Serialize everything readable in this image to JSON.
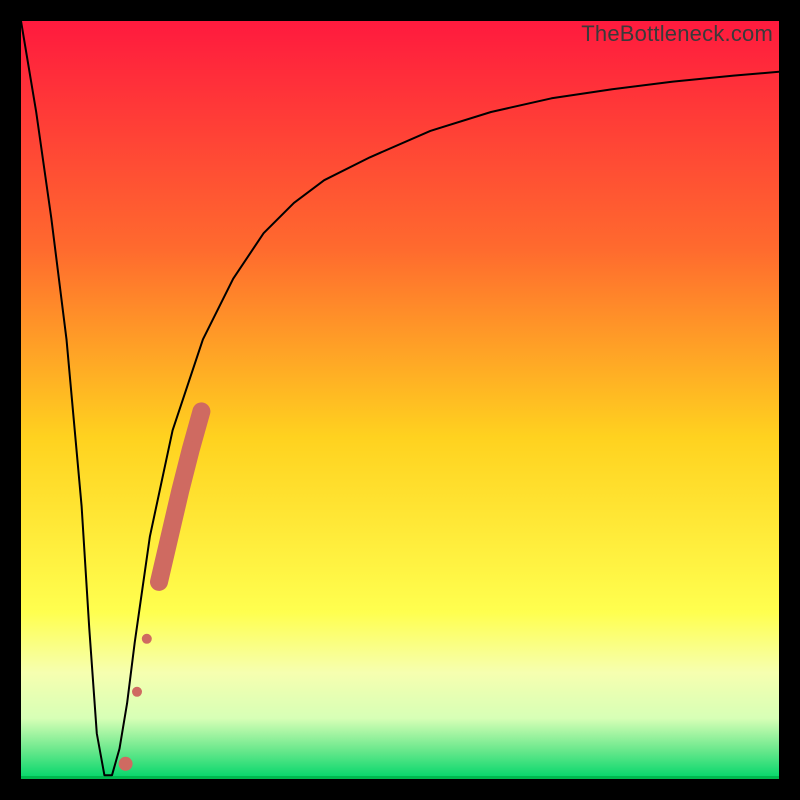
{
  "watermark": "TheBottleneck.com",
  "chart_data": {
    "type": "line",
    "title": "",
    "xlabel": "",
    "ylabel": "",
    "xlim": [
      0,
      100
    ],
    "ylim": [
      0,
      100
    ],
    "gradient_stops": [
      {
        "offset": 0,
        "color": "#ff1a3e"
      },
      {
        "offset": 30,
        "color": "#ff6a2e"
      },
      {
        "offset": 55,
        "color": "#ffd21f"
      },
      {
        "offset": 78,
        "color": "#ffff4f"
      },
      {
        "offset": 86,
        "color": "#f6ffb0"
      },
      {
        "offset": 92,
        "color": "#d7ffb6"
      },
      {
        "offset": 96,
        "color": "#6fe98e"
      },
      {
        "offset": 100,
        "color": "#00d66a"
      }
    ],
    "series": [
      {
        "name": "bottleneck-curve",
        "x": [
          0,
          2,
          4,
          6,
          8,
          9,
          10,
          11,
          12,
          13,
          14,
          15,
          17,
          20,
          24,
          28,
          32,
          36,
          40,
          46,
          54,
          62,
          70,
          78,
          86,
          94,
          100
        ],
        "y": [
          100,
          88,
          74,
          58,
          36,
          20,
          6,
          0.5,
          0.5,
          4,
          10,
          18,
          32,
          46,
          58,
          66,
          72,
          76,
          79,
          82,
          85.5,
          88,
          89.8,
          91,
          92,
          92.8,
          93.3
        ]
      }
    ],
    "markers": {
      "name": "emphasis-dots",
      "color": "#cf6a61",
      "stroke_radius": 9,
      "points": [
        {
          "x": 13.8,
          "y": 2.0,
          "r": 7
        },
        {
          "x": 15.3,
          "y": 11.5,
          "r": 5
        },
        {
          "x": 16.6,
          "y": 18.5,
          "r": 5
        },
        {
          "x": 18.2,
          "y": 26.0,
          "r": 8
        },
        {
          "x": 19.6,
          "y": 32.0,
          "r": 8
        },
        {
          "x": 21.0,
          "y": 38.0,
          "r": 8
        },
        {
          "x": 22.4,
          "y": 43.5,
          "r": 8
        },
        {
          "x": 23.8,
          "y": 48.5,
          "r": 8
        }
      ]
    }
  }
}
